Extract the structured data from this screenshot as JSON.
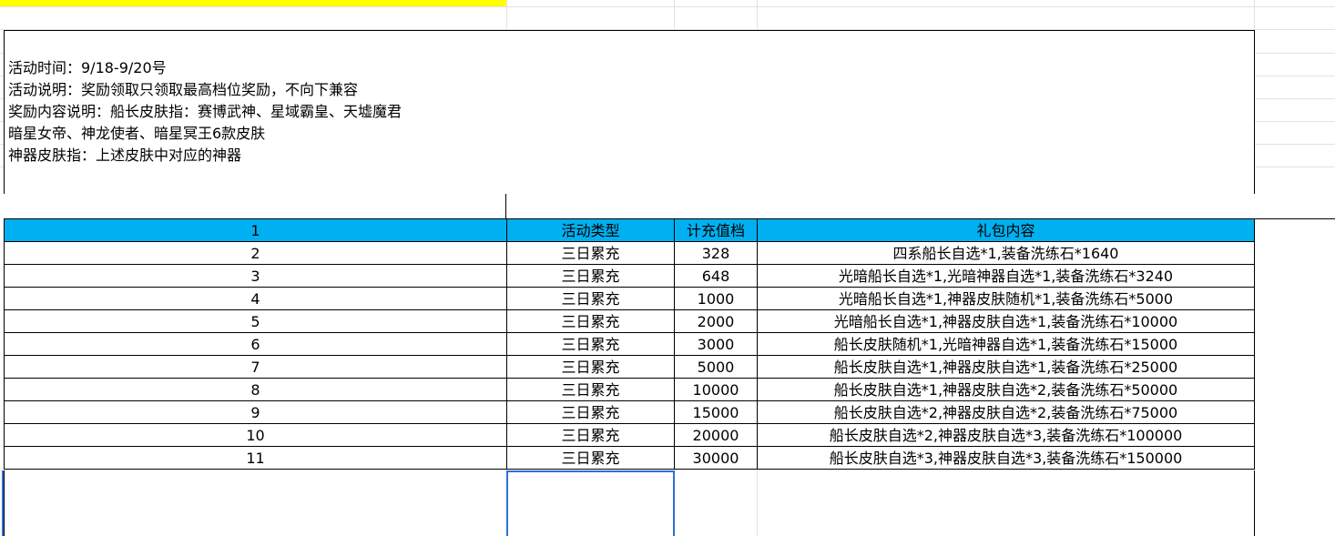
{
  "notice": {
    "lines": [
      "活动时间：9/18-9/20号",
      "活动说明：奖励领取只领取最高档位奖励，不向下兼容",
      "奖励内容说明：船长皮肤指：赛博武神、星域霸皇、天墟魔君",
      "暗星女帝、神龙使者、暗星冥王6款皮肤",
      "神器皮肤指：上述皮肤中对应的神器"
    ]
  },
  "table": {
    "header": [
      "1",
      "活动类型",
      "计充值档",
      "礼包内容"
    ],
    "rows": [
      [
        "2",
        "三日累充",
        "328",
        "四系船长自选*1,装备洗练石*1640"
      ],
      [
        "3",
        "三日累充",
        "648",
        "光暗船长自选*1,光暗神器自选*1,装备洗练石*3240"
      ],
      [
        "4",
        "三日累充",
        "1000",
        "光暗船长自选*1,神器皮肤随机*1,装备洗练石*5000"
      ],
      [
        "5",
        "三日累充",
        "2000",
        "光暗船长自选*1,神器皮肤自选*1,装备洗练石*10000"
      ],
      [
        "6",
        "三日累充",
        "3000",
        "船长皮肤随机*1,光暗神器自选*1,装备洗练石*15000"
      ],
      [
        "7",
        "三日累充",
        "5000",
        "船长皮肤自选*1,神器皮肤自选*1,装备洗练石*25000"
      ],
      [
        "8",
        "三日累充",
        "10000",
        "船长皮肤自选*1,神器皮肤自选*2,装备洗练石*50000"
      ],
      [
        "9",
        "三日累充",
        "15000",
        "船长皮肤自选*2,神器皮肤自选*2,装备洗练石*75000"
      ],
      [
        "10",
        "三日累充",
        "20000",
        "船长皮肤自选*2,神器皮肤自选*3,装备洗练石*100000"
      ],
      [
        "11",
        "三日累充",
        "30000",
        "船长皮肤自选*3,神器皮肤自选*3,装备洗练石*150000"
      ]
    ]
  },
  "colors": {
    "header_fill": "#00b0f0",
    "highlight_strip": "#ffff00",
    "selection_border": "#2f6fd6"
  }
}
